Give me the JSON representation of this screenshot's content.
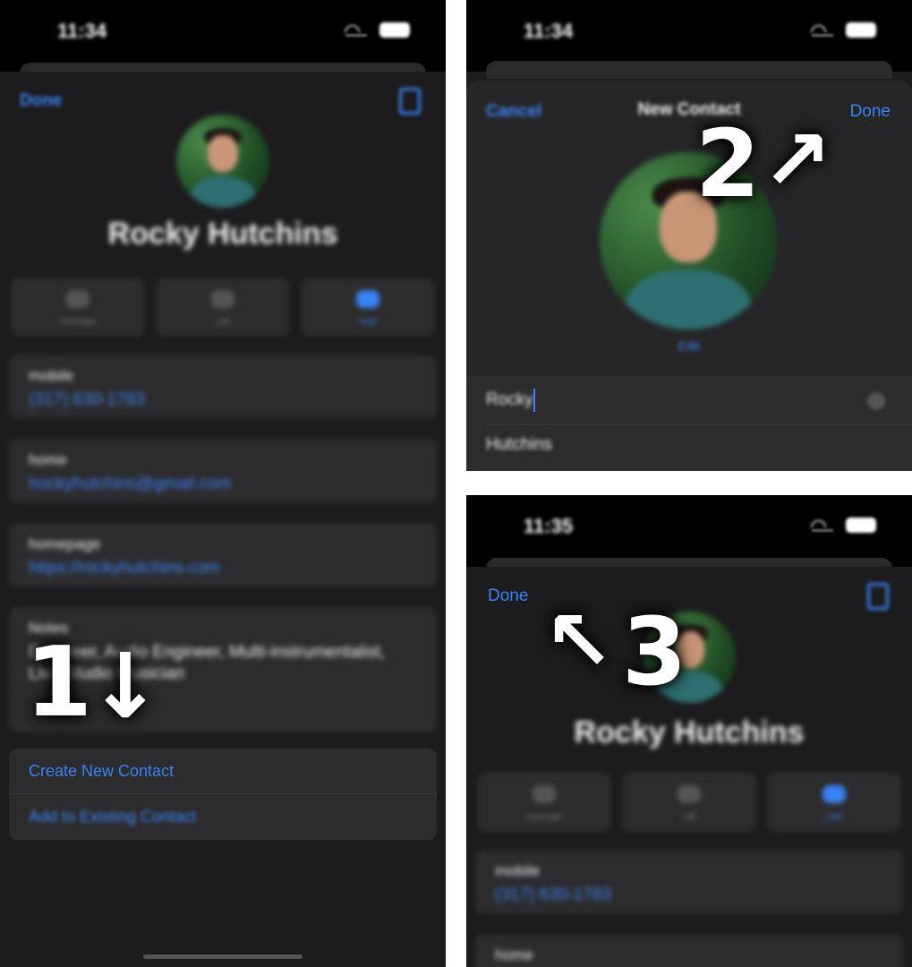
{
  "panel1": {
    "time": "11:34",
    "done": "Done",
    "name": "Rocky Hutchins",
    "actions": [
      {
        "label": "message",
        "icon": "message-icon"
      },
      {
        "label": "call",
        "icon": "phone-icon"
      },
      {
        "label": "mail",
        "icon": "mail-icon"
      }
    ],
    "fields": [
      {
        "label": "mobile",
        "value": "(317) 630-1783"
      },
      {
        "label": "home",
        "value": "hockyhutchins@gmail.com"
      },
      {
        "label": "homepage",
        "value": "https://rockyhutchins.com"
      }
    ],
    "notes_label": "Notes",
    "notes_line1": "Engineer, Audio Engineer, Multi-instrumentalist,",
    "notes_line2": "Live Studio Musician",
    "create_new": "Create New Contact",
    "add_existing": "Add to Existing Contact",
    "step": "1",
    "step_arrow": "↓"
  },
  "panel2": {
    "time": "11:34",
    "cancel": "Cancel",
    "title": "New Contact",
    "done": "Done",
    "edit": "Edit",
    "first_name": "Rocky",
    "last_name": "Hutchins",
    "step": "2",
    "step_arrow": "↗"
  },
  "panel3": {
    "time": "11:35",
    "done": "Done",
    "name": "Rocky Hutchins",
    "actions": [
      {
        "label": "message",
        "icon": "message-icon"
      },
      {
        "label": "call",
        "icon": "phone-icon"
      },
      {
        "label": "mail",
        "icon": "mail-icon"
      }
    ],
    "fields": [
      {
        "label": "mobile",
        "value": "(317) 630-1783"
      },
      {
        "label": "home",
        "value": ""
      }
    ],
    "step": "3",
    "step_arrow": "↖"
  },
  "colors": {
    "accent": "#3b82f6",
    "background": "#1c1c1e",
    "card": "#2c2c2e"
  }
}
